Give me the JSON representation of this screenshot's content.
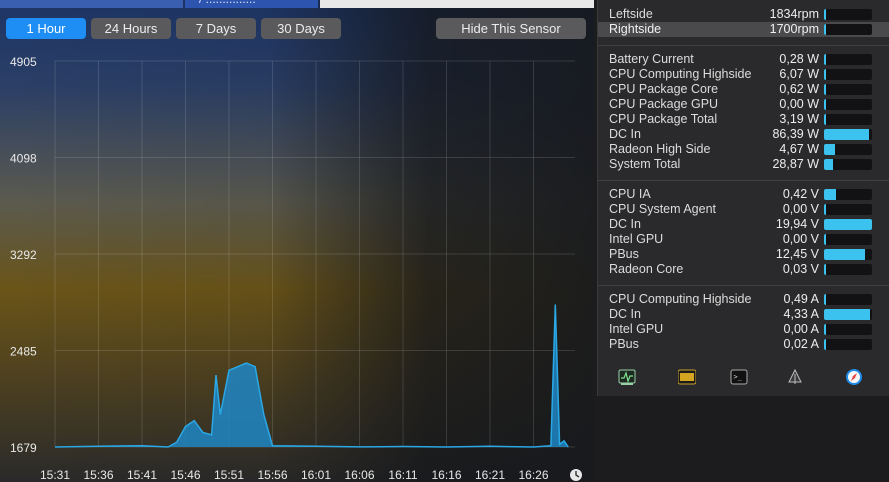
{
  "range_buttons": [
    {
      "label": "1 Hour",
      "active": true
    },
    {
      "label": "24 Hours",
      "active": false
    },
    {
      "label": "7 Days",
      "active": false
    },
    {
      "label": "30 Days",
      "active": false
    }
  ],
  "hide_sensor_label": "Hide This Sensor",
  "top_strip": {
    "partial_text": "/ ...............",
    "colors": [
      "#3a5fb0",
      "#2d55b0",
      "#e8e8e8"
    ]
  },
  "chart_data": {
    "type": "area",
    "title": "",
    "xlabel": "",
    "ylabel": "",
    "y_ticks": [
      "4905",
      "4098",
      "3292",
      "2485",
      "1679"
    ],
    "ylim": [
      1679,
      4905
    ],
    "x_ticks": [
      "15:31",
      "15:36",
      "15:41",
      "15:46",
      "15:51",
      "15:56",
      "16:01",
      "16:06",
      "16:11",
      "16:16",
      "16:21",
      "16:26"
    ],
    "grid": true,
    "color": "#1f86c4",
    "series": [
      {
        "x": [
          "15:31",
          "15:36",
          "15:41",
          "15:44",
          "15:45",
          "15:46",
          "15:47",
          "15:48",
          "15:49",
          "15:49.5",
          "15:50",
          "15:51",
          "15:52",
          "15:53",
          "15:54",
          "15:55",
          "15:56",
          "16:01",
          "16:06",
          "16:11",
          "16:16",
          "16:21",
          "16:26",
          "16:28",
          "16:28.5",
          "16:29",
          "16:29.5",
          "16:30"
        ],
        "values": [
          1679,
          1685,
          1690,
          1679,
          1720,
          1850,
          1900,
          1800,
          1780,
          2280,
          1950,
          2320,
          2350,
          2380,
          2350,
          1950,
          1690,
          1685,
          1680,
          1683,
          1679,
          1685,
          1679,
          1690,
          2870,
          1700,
          1730,
          1679
        ]
      }
    ],
    "clock_icon": "clock-icon"
  },
  "sensors": {
    "fans": [
      {
        "label": "Leftside",
        "value": "1834rpm",
        "level": 0.0,
        "selected": false
      },
      {
        "label": "Rightside",
        "value": "1700rpm",
        "level": 0.0,
        "selected": true
      }
    ],
    "power": [
      {
        "label": "Battery Current",
        "value": "0,28 W",
        "level": 0.0
      },
      {
        "label": "CPU Computing Highside",
        "value": "6,07 W",
        "level": 0.04
      },
      {
        "label": "CPU Package Core",
        "value": "0,62 W",
        "level": 0.0
      },
      {
        "label": "CPU Package GPU",
        "value": "0,00 W",
        "level": 0.0
      },
      {
        "label": "CPU Package Total",
        "value": "3,19 W",
        "level": 0.02
      },
      {
        "label": "DC In",
        "value": "86,39 W",
        "level": 0.94
      },
      {
        "label": "Radeon High Side",
        "value": "4,67 W",
        "level": 0.22
      },
      {
        "label": "System Total",
        "value": "28,87 W",
        "level": 0.19
      }
    ],
    "voltage": [
      {
        "label": "CPU IA",
        "value": "0,42 V",
        "level": 0.26
      },
      {
        "label": "CPU System Agent",
        "value": "0,00 V",
        "level": 0.0
      },
      {
        "label": "DC In",
        "value": "19,94 V",
        "level": 1.0
      },
      {
        "label": "Intel GPU",
        "value": "0,00 V",
        "level": 0.0
      },
      {
        "label": "PBus",
        "value": "12,45 V",
        "level": 0.85
      },
      {
        "label": "Radeon Core",
        "value": "0,03 V",
        "level": 0.04
      }
    ],
    "current": [
      {
        "label": "CPU Computing Highside",
        "value": "0,49 A",
        "level": 0.03
      },
      {
        "label": "DC In",
        "value": "4,33 A",
        "level": 0.96
      },
      {
        "label": "Intel GPU",
        "value": "0,00 A",
        "level": 0.0
      },
      {
        "label": "PBus",
        "value": "0,02 A",
        "level": 0.0
      }
    ]
  },
  "toolbar": {
    "icons": [
      "activity-monitor-icon",
      "radeon-badge-icon",
      "terminal-icon",
      "tree-icon",
      "safari-icon"
    ],
    "radeon_badge_text": "RADEON RX 5 Pro"
  }
}
